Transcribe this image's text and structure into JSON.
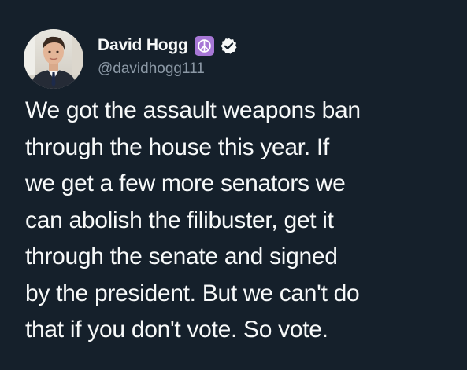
{
  "tweet": {
    "display_name": "David Hogg",
    "handle": "@davidhogg111",
    "text": "We got the assault weapons ban\nthrough the house this year. If\nwe get a few more senators we\ncan abolish the filibuster, get it\nthrough the senate and signed\nby the president. But we can't do\nthat if you don't vote. So vote.",
    "badges": [
      "peace-sign-icon",
      "verified-badge-icon"
    ]
  },
  "colors": {
    "background": "#15202b",
    "text": "#f7f9f9",
    "handle": "#8b98a5",
    "peace_badge": "#a777d6"
  }
}
